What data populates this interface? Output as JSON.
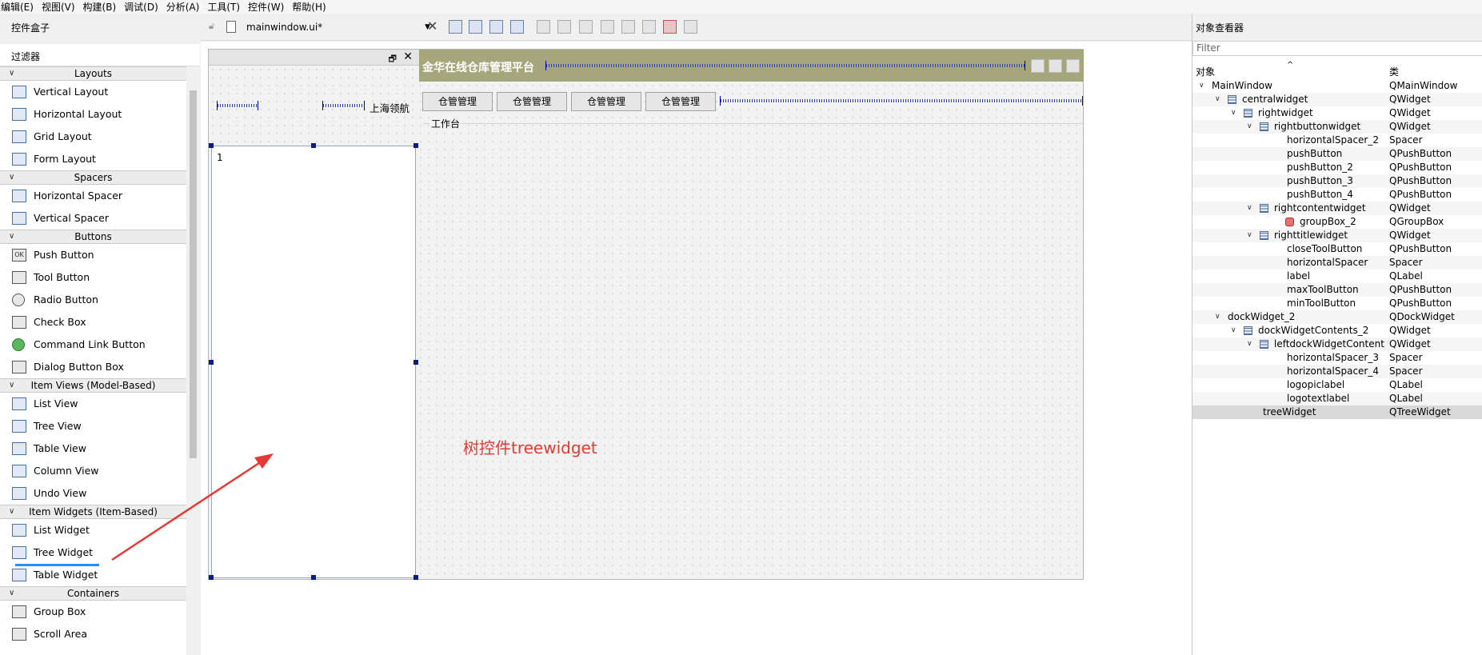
{
  "menubar": [
    "编辑(E)",
    "视图(V)",
    "构建(B)",
    "调试(D)",
    "分析(A)",
    "工具(T)",
    "控件(W)",
    "帮助(H)"
  ],
  "widget_box": {
    "title": "控件盒子",
    "filter_label": "过滤器",
    "categories": [
      {
        "name": "Layouts",
        "items": [
          {
            "label": "Vertical Layout",
            "icon": "vertical-layout-icon"
          },
          {
            "label": "Horizontal Layout",
            "icon": "horizontal-layout-icon"
          },
          {
            "label": "Grid Layout",
            "icon": "grid-layout-icon"
          },
          {
            "label": "Form Layout",
            "icon": "form-layout-icon"
          }
        ]
      },
      {
        "name": "Spacers",
        "items": [
          {
            "label": "Horizontal Spacer",
            "icon": "horizontal-spacer-icon"
          },
          {
            "label": "Vertical Spacer",
            "icon": "vertical-spacer-icon"
          }
        ]
      },
      {
        "name": "Buttons",
        "items": [
          {
            "label": "Push Button",
            "icon": "push-button-icon",
            "glyph": "OK"
          },
          {
            "label": "Tool Button",
            "icon": "tool-button-icon"
          },
          {
            "label": "Radio Button",
            "icon": "radio-button-icon"
          },
          {
            "label": "Check Box",
            "icon": "check-box-icon"
          },
          {
            "label": "Command Link Button",
            "icon": "command-link-icon"
          },
          {
            "label": "Dialog Button Box",
            "icon": "dialog-button-box-icon"
          }
        ]
      },
      {
        "name": "Item Views (Model-Based)",
        "items": [
          {
            "label": "List View",
            "icon": "list-view-icon"
          },
          {
            "label": "Tree View",
            "icon": "tree-view-icon"
          },
          {
            "label": "Table View",
            "icon": "table-view-icon"
          },
          {
            "label": "Column View",
            "icon": "column-view-icon"
          },
          {
            "label": "Undo View",
            "icon": "undo-view-icon"
          }
        ]
      },
      {
        "name": "Item Widgets (Item-Based)",
        "items": [
          {
            "label": "List Widget",
            "icon": "list-widget-icon"
          },
          {
            "label": "Tree Widget",
            "icon": "tree-widget-icon"
          },
          {
            "label": "Table Widget",
            "icon": "table-widget-icon"
          }
        ]
      },
      {
        "name": "Containers",
        "items": [
          {
            "label": "Group Box",
            "icon": "group-box-icon"
          },
          {
            "label": "Scroll Area",
            "icon": "scroll-area-icon"
          }
        ]
      }
    ]
  },
  "editor": {
    "file_name": "mainwindow.ui*"
  },
  "form": {
    "logo_text": "上海领航",
    "tree_first_item": "1",
    "annotation": "树控件treewidget",
    "title": "金华在线仓库管理平台",
    "buttons": [
      "仓管管理",
      "仓管管理",
      "仓管管理",
      "仓管管理"
    ],
    "group_title": "工作台"
  },
  "inspector": {
    "title": "对象查看器",
    "filter_placeholder": "Filter",
    "col_object": "对象",
    "col_class": "类",
    "rows": [
      {
        "name": "MainWindow",
        "cls": "QMainWindow",
        "depth": 0,
        "expanded": true,
        "icon": false
      },
      {
        "name": "centralwidget",
        "cls": "QWidget",
        "depth": 1,
        "expanded": true,
        "icon": true
      },
      {
        "name": "rightwidget",
        "cls": "QWidget",
        "depth": 2,
        "expanded": true,
        "icon": true
      },
      {
        "name": "rightbuttonwidget",
        "cls": "QWidget",
        "depth": 3,
        "expanded": true,
        "icon": true
      },
      {
        "name": "horizontalSpacer_2",
        "cls": "Spacer",
        "depth": 4,
        "expanded": false,
        "icon": false
      },
      {
        "name": "pushButton",
        "cls": "QPushButton",
        "depth": 4,
        "expanded": false,
        "icon": false
      },
      {
        "name": "pushButton_2",
        "cls": "QPushButton",
        "depth": 4,
        "expanded": false,
        "icon": false
      },
      {
        "name": "pushButton_3",
        "cls": "QPushButton",
        "depth": 4,
        "expanded": false,
        "icon": false
      },
      {
        "name": "pushButton_4",
        "cls": "QPushButton",
        "depth": 4,
        "expanded": false,
        "icon": false
      },
      {
        "name": "rightcontentwidget",
        "cls": "QWidget",
        "depth": 3,
        "expanded": true,
        "icon": true
      },
      {
        "name": "groupBox_2",
        "cls": "QGroupBox",
        "depth": 5,
        "expanded": false,
        "icon": "red"
      },
      {
        "name": "righttitlewidget",
        "cls": "QWidget",
        "depth": 3,
        "expanded": true,
        "icon": true
      },
      {
        "name": "closeToolButton",
        "cls": "QPushButton",
        "depth": 4,
        "expanded": false,
        "icon": false
      },
      {
        "name": "horizontalSpacer",
        "cls": "Spacer",
        "depth": 4,
        "expanded": false,
        "icon": false
      },
      {
        "name": "label",
        "cls": "QLabel",
        "depth": 4,
        "expanded": false,
        "icon": false
      },
      {
        "name": "maxToolButton",
        "cls": "QPushButton",
        "depth": 4,
        "expanded": false,
        "icon": false
      },
      {
        "name": "minToolButton",
        "cls": "QPushButton",
        "depth": 4,
        "expanded": false,
        "icon": false
      },
      {
        "name": "dockWidget_2",
        "cls": "QDockWidget",
        "depth": 1,
        "expanded": true,
        "icon": false
      },
      {
        "name": "dockWidgetContents_2",
        "cls": "QWidget",
        "depth": 2,
        "expanded": true,
        "icon": true
      },
      {
        "name": "leftdockWidgetContent",
        "cls": "QWidget",
        "depth": 3,
        "expanded": true,
        "icon": true
      },
      {
        "name": "horizontalSpacer_3",
        "cls": "Spacer",
        "depth": 4,
        "expanded": false,
        "icon": false
      },
      {
        "name": "horizontalSpacer_4",
        "cls": "Spacer",
        "depth": 4,
        "expanded": false,
        "icon": false
      },
      {
        "name": "logopiclabel",
        "cls": "QLabel",
        "depth": 4,
        "expanded": false,
        "icon": false
      },
      {
        "name": "logotextlabel",
        "cls": "QLabel",
        "depth": 4,
        "expanded": false,
        "icon": false
      },
      {
        "name": "treeWidget",
        "cls": "QTreeWidget",
        "depth": 3.5,
        "expanded": false,
        "icon": false,
        "selected": true
      }
    ]
  },
  "colors": {
    "title_bar": "#a5a67b",
    "annotation": "#e53935",
    "selection_underline": "#1e90ff",
    "spacer_blue": "#2a3bd1"
  }
}
